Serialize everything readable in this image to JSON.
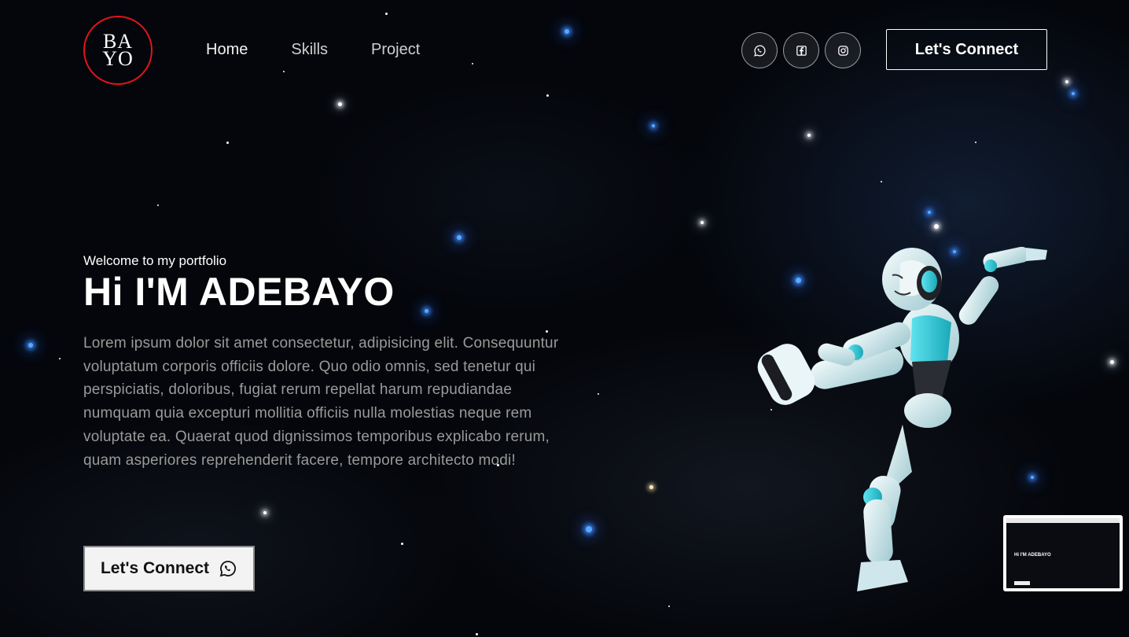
{
  "logo": {
    "line1": "BA",
    "line2": "YO"
  },
  "nav": {
    "items": [
      {
        "label": "Home"
      },
      {
        "label": "Skills"
      },
      {
        "label": "Project"
      }
    ]
  },
  "socials": [
    {
      "icon": "whatsapp-icon"
    },
    {
      "icon": "facebook-icon"
    },
    {
      "icon": "instagram-icon"
    }
  ],
  "header": {
    "connect_label": "Let's Connect"
  },
  "hero": {
    "welcome": "Welcome to my portfolio",
    "title": "Hi I'M ADEBAYO",
    "description": "Lorem ipsum dolor sit amet consectetur, adipisicing elit. Consequuntur voluptatum corporis officiis dolore. Quo odio omnis, sed tenetur qui perspiciatis, doloribus, fugiat rerum repellat harum repudiandae numquam quia excepturi mollitia officiis nulla molestias neque rem voluptate ea. Quaerat quod dignissimos temporibus explicabo rerum, quam asperiores reprehenderit facere, tempore architecto modi!",
    "connect_label": "Let's Connect"
  },
  "thumbnail": {
    "title": "Hi I'M ADEBAYO"
  },
  "colors": {
    "logo_ring": "#e0151b",
    "background": "#05070c",
    "robot_accent": "#2fd0e0",
    "description_text": "#9a9a9a"
  }
}
